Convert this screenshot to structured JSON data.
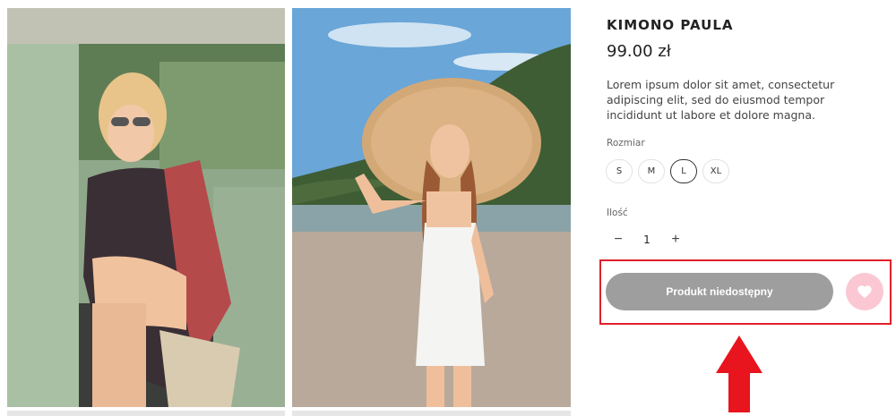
{
  "gallery": {
    "images": [
      {
        "alt": "Woman in floral kimono sitting in vintage van"
      },
      {
        "alt": "Woman in straw hat and white dress on beach"
      }
    ]
  },
  "product": {
    "title": "KIMONO PAULA",
    "price": "99.00 zł",
    "description": "Lorem ipsum dolor sit amet, consectetur adipiscing elit, sed do eiusmod tempor incididunt ut labore et dolore magna."
  },
  "size": {
    "label": "Rozmiar",
    "options": [
      "S",
      "M",
      "L",
      "XL"
    ],
    "selected": "L"
  },
  "quantity": {
    "label": "Ilość",
    "value": "1",
    "minus": "−",
    "plus": "+"
  },
  "cart": {
    "button_label": "Produkt niedostępny",
    "button_color": "#9e9e9e",
    "wishlist_icon": "heart-icon",
    "wishlist_color": "#fbc7d3"
  },
  "annotation": {
    "box_color": "#e0202a",
    "arrow_color": "#e8141e"
  }
}
